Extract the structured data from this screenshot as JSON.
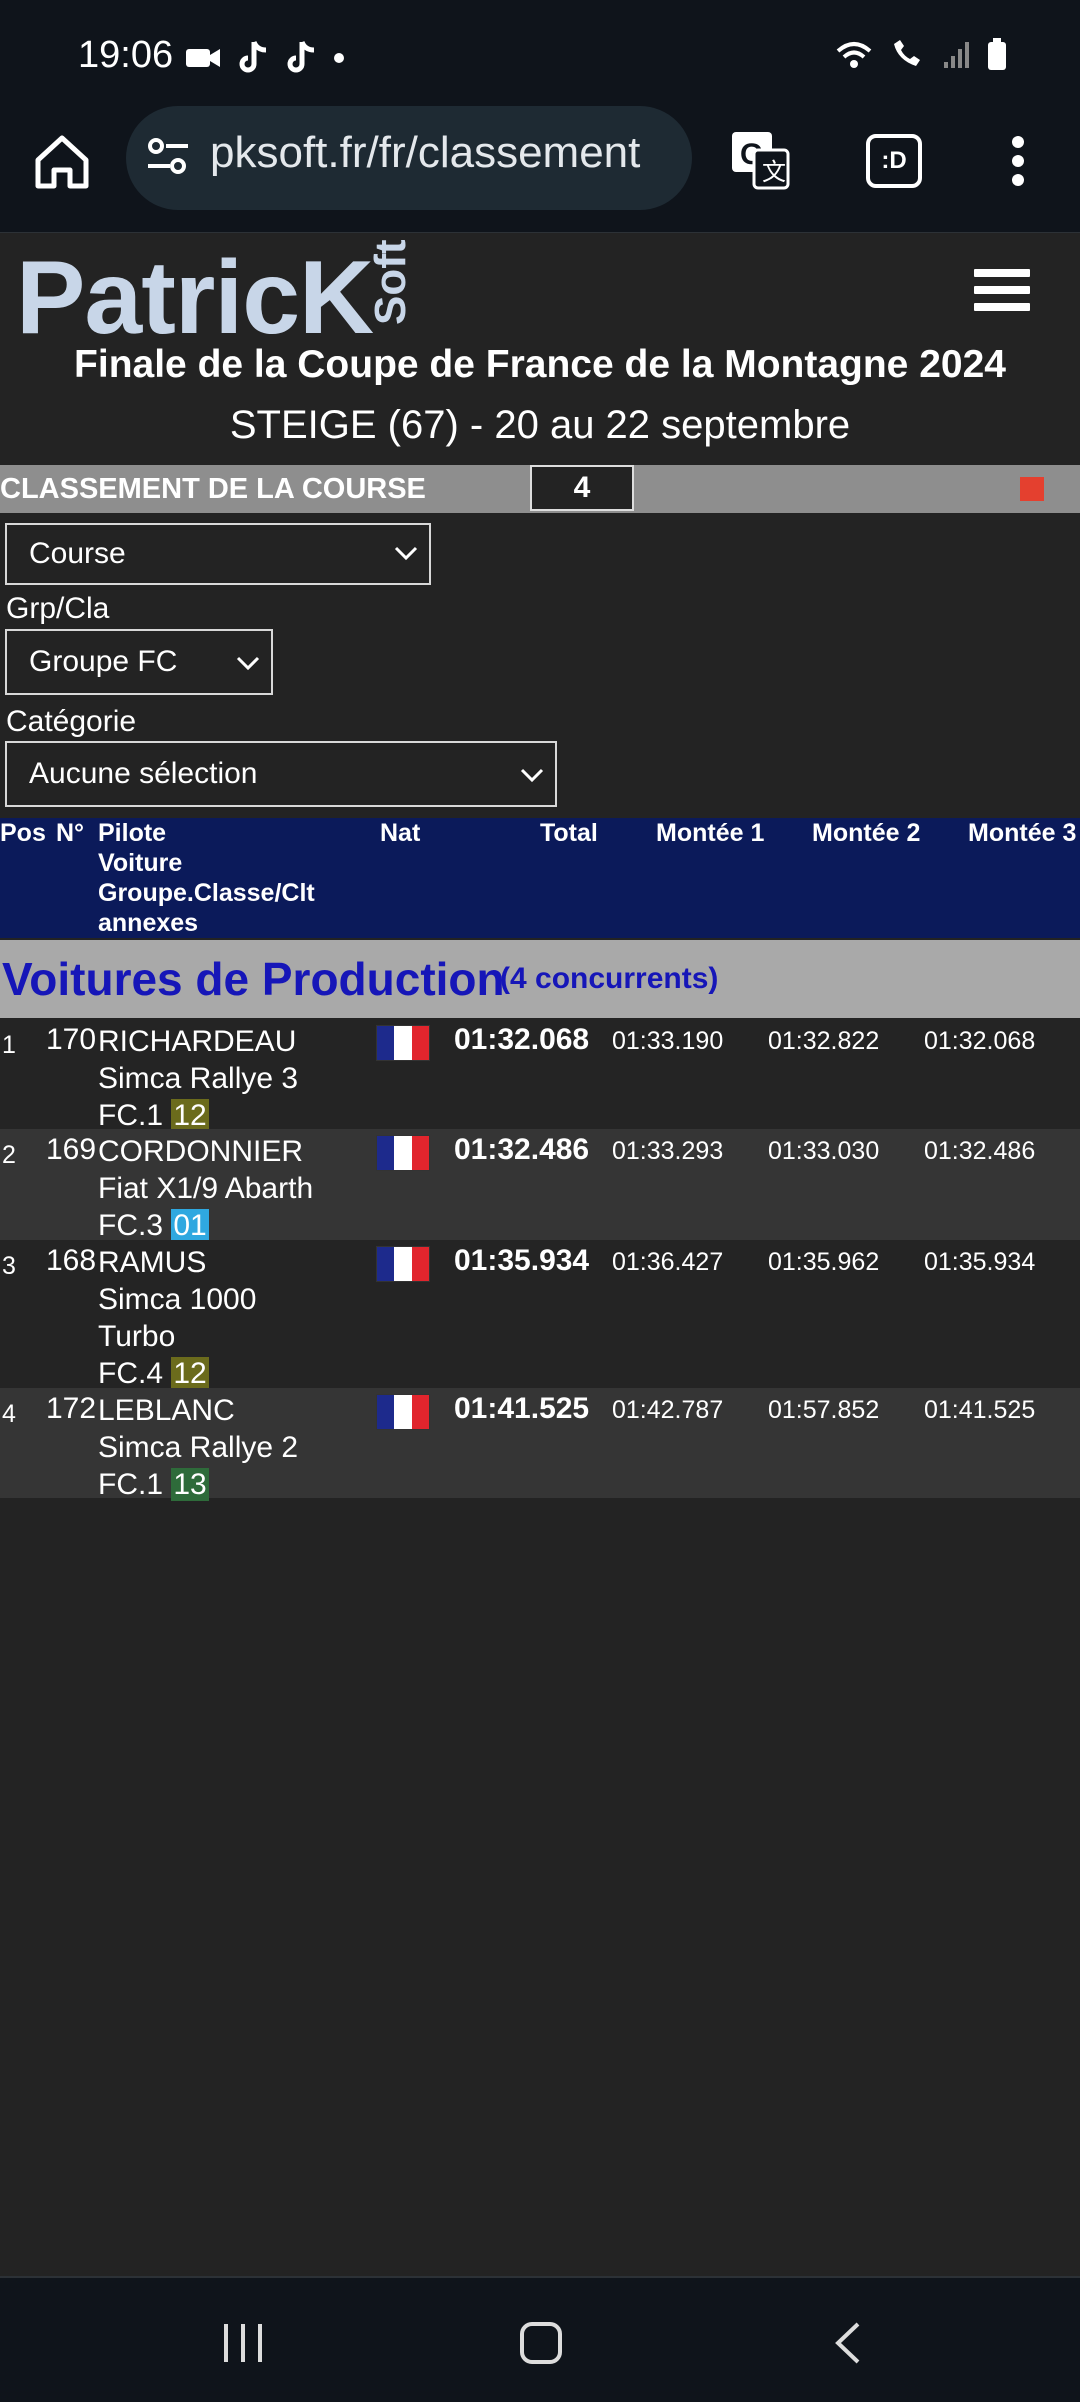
{
  "status_bar": {
    "time": "19:06"
  },
  "browser": {
    "url": "pksoft.fr/fr/classement",
    "tabs_label": ":D"
  },
  "header": {
    "logo_main": "PatricK",
    "logo_sub": "Soft",
    "event_title": "Finale de la Coupe de France de la Montagne 2024",
    "event_subtitle": "STEIGE (67) - 20 au 22 septembre"
  },
  "classement": {
    "label": "CLASSEMENT DE LA COURSE",
    "race_number": "4"
  },
  "filters": {
    "course_select": "Course",
    "grp_label": "Grp/Cla",
    "grp_select": "Groupe FC",
    "cat_label": "Catégorie",
    "cat_select": "Aucune sélection"
  },
  "table": {
    "headers": {
      "pos": "Pos",
      "num": "N°",
      "pilote_lines": [
        "Pilote",
        "Voiture",
        "Groupe.Classe/Clt",
        "annexes"
      ],
      "nat": "Nat",
      "total": "Total",
      "m1": "Montée 1",
      "m2": "Montée 2",
      "m3": "Montée 3"
    },
    "group": {
      "title": "Voitures de Production",
      "count": "(4 concurrents)"
    },
    "rows": [
      {
        "pos": "1",
        "num": "170",
        "pilot": "RICHARDEAU",
        "car_lines": [
          "Simca Rallye 3"
        ],
        "class": "FC.1",
        "clt": "12",
        "clt_color": "#6b6b1c",
        "total": "01:32.068",
        "m1": "01:33.190",
        "m2": "01:32.822",
        "m3": "01:32.068"
      },
      {
        "pos": "2",
        "num": "169",
        "pilot": "CORDONNIER",
        "car_lines": [
          "Fiat X1/9 Abarth"
        ],
        "class": "FC.3",
        "clt": "01",
        "clt_color": "#2fa8e0",
        "total": "01:32.486",
        "m1": "01:33.293",
        "m2": "01:33.030",
        "m3": "01:32.486"
      },
      {
        "pos": "3",
        "num": "168",
        "pilot": "RAMUS",
        "car_lines": [
          "Simca 1000",
          "Turbo"
        ],
        "class": "FC.4",
        "clt": "12",
        "clt_color": "#6b6b1c",
        "total": "01:35.934",
        "m1": "01:36.427",
        "m2": "01:35.962",
        "m3": "01:35.934"
      },
      {
        "pos": "4",
        "num": "172",
        "pilot": "LEBLANC",
        "car_lines": [
          "Simca Rallye 2"
        ],
        "class": "FC.1",
        "clt": "13",
        "clt_color": "#2e6b3a",
        "total": "01:41.525",
        "m1": "01:42.787",
        "m2": "01:57.852",
        "m3": "01:41.525"
      }
    ]
  }
}
